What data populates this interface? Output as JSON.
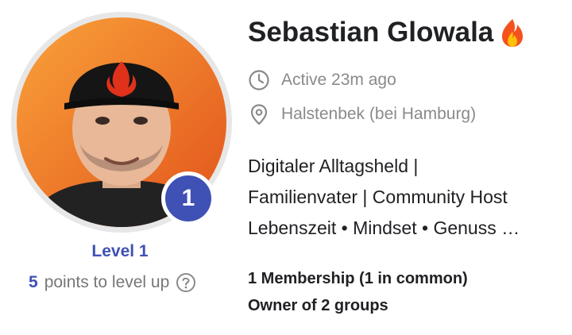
{
  "profile": {
    "name": "Sebastian Glowala",
    "badge_icon": "fire-icon",
    "active_status": "Active 23m ago",
    "location": "Halstenbek (bei Hamburg)",
    "bio_lines": [
      "Digitaler Alltagsheld |",
      "Familienvater | Community Host",
      "Lebenszeit • Mindset • Genuss …"
    ],
    "membership": "1 Membership (1 in common)",
    "owner": "Owner of 2 groups"
  },
  "level": {
    "number": "1",
    "label": "Level 1",
    "points_needed": "5",
    "points_text": "points to level up",
    "help_icon": "question-circle-icon"
  },
  "colors": {
    "accent": "#3f51b5",
    "text": "#202124",
    "muted": "#8a8a8a",
    "avatar_background": "#ef6c1e"
  }
}
